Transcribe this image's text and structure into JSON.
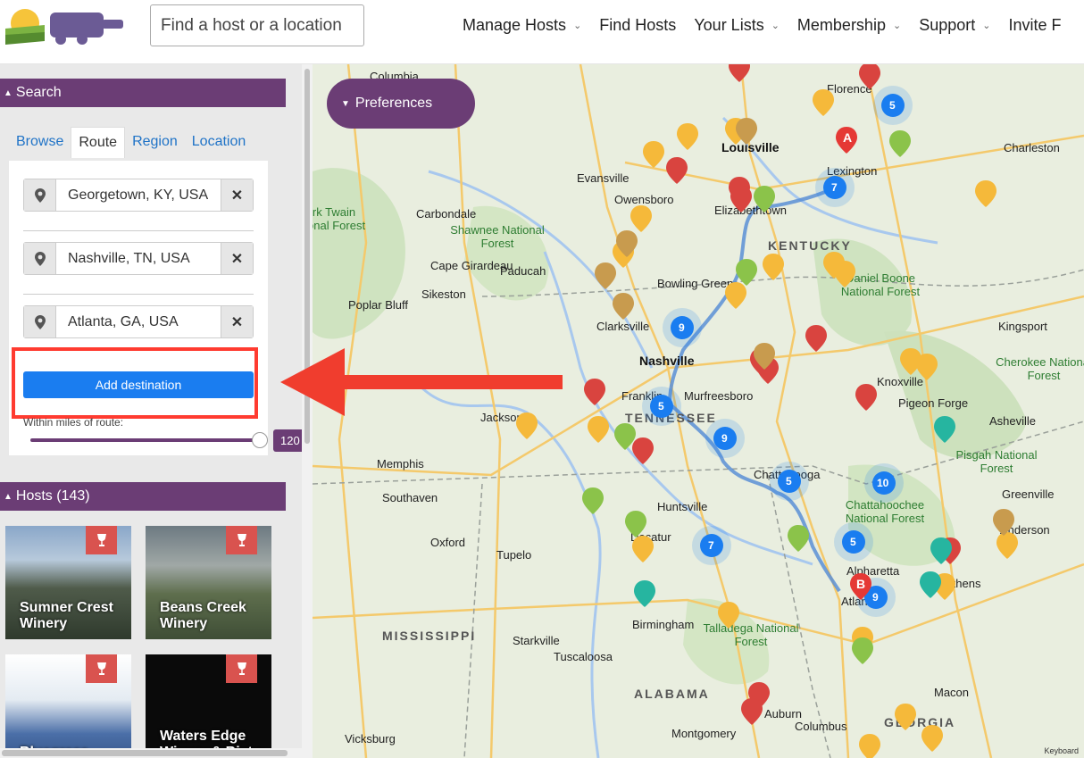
{
  "header": {
    "search_placeholder": "Find a host or a location",
    "nav": [
      "Manage Hosts",
      "Find Hosts",
      "Your Lists",
      "Membership",
      "Support",
      "Invite F"
    ]
  },
  "search_panel": {
    "title": "Search",
    "tabs": [
      "Browse",
      "Route",
      "Region",
      "Location"
    ],
    "active_tab": "Route",
    "locations": [
      "Georgetown, KY, USA",
      "Nashville, TN, USA",
      "Atlanta, GA, USA"
    ],
    "add_destination": "Add destination",
    "miles_label": "Within miles of route:",
    "slider_value": "120"
  },
  "hosts_panel": {
    "title": "Hosts (143)",
    "hosts": [
      "Sumner Crest Winery",
      "Beans Creek Winery",
      "Bluegrass",
      "Waters Edge Winery & Bistro"
    ]
  },
  "map": {
    "preferences": "Preferences",
    "keyboard": "Keyboard",
    "states": [
      "KENTUCKY",
      "TENNESSEE",
      "MISSISSIPPI",
      "ALABAMA",
      "GEORGIA"
    ],
    "forests": [
      "Shawnee National Forest",
      "Daniel Boone National Forest",
      "Cherokee National Forest",
      "Pisgah National Forest",
      "Chattahoochee National Forest",
      "Talladega National Forest",
      "Mark Twain National Forest"
    ],
    "cities": [
      "Louisville",
      "Lexington",
      "Evansville",
      "Owensboro",
      "Elizabethtown",
      "Bowling Green",
      "Clarksville",
      "Nashville",
      "Franklin",
      "Murfreesboro",
      "Knoxville",
      "Kingsport",
      "Asheville",
      "Chattanooga",
      "Huntsville",
      "Memphis",
      "Jackson",
      "Paducah",
      "Cape Girardeau",
      "Carbondale",
      "Sikeston",
      "Poplar Bluff",
      "Southaven",
      "Oxford",
      "Tupelo",
      "Decatur",
      "Birmingham",
      "Tuscaloosa",
      "Starkville",
      "Alpharetta",
      "Athens",
      "Atlanta",
      "Greenville",
      "Anderson",
      "Macon",
      "Columbus",
      "Montgomery",
      "Auburn",
      "Vicksburg",
      "Charleston",
      "Florence",
      "Columbia",
      "Pigeon Forge"
    ],
    "clusters": [
      "5",
      "7",
      "9",
      "5",
      "9",
      "5",
      "10",
      "5",
      "7",
      "9"
    ],
    "markers": [
      "A",
      "B"
    ]
  }
}
